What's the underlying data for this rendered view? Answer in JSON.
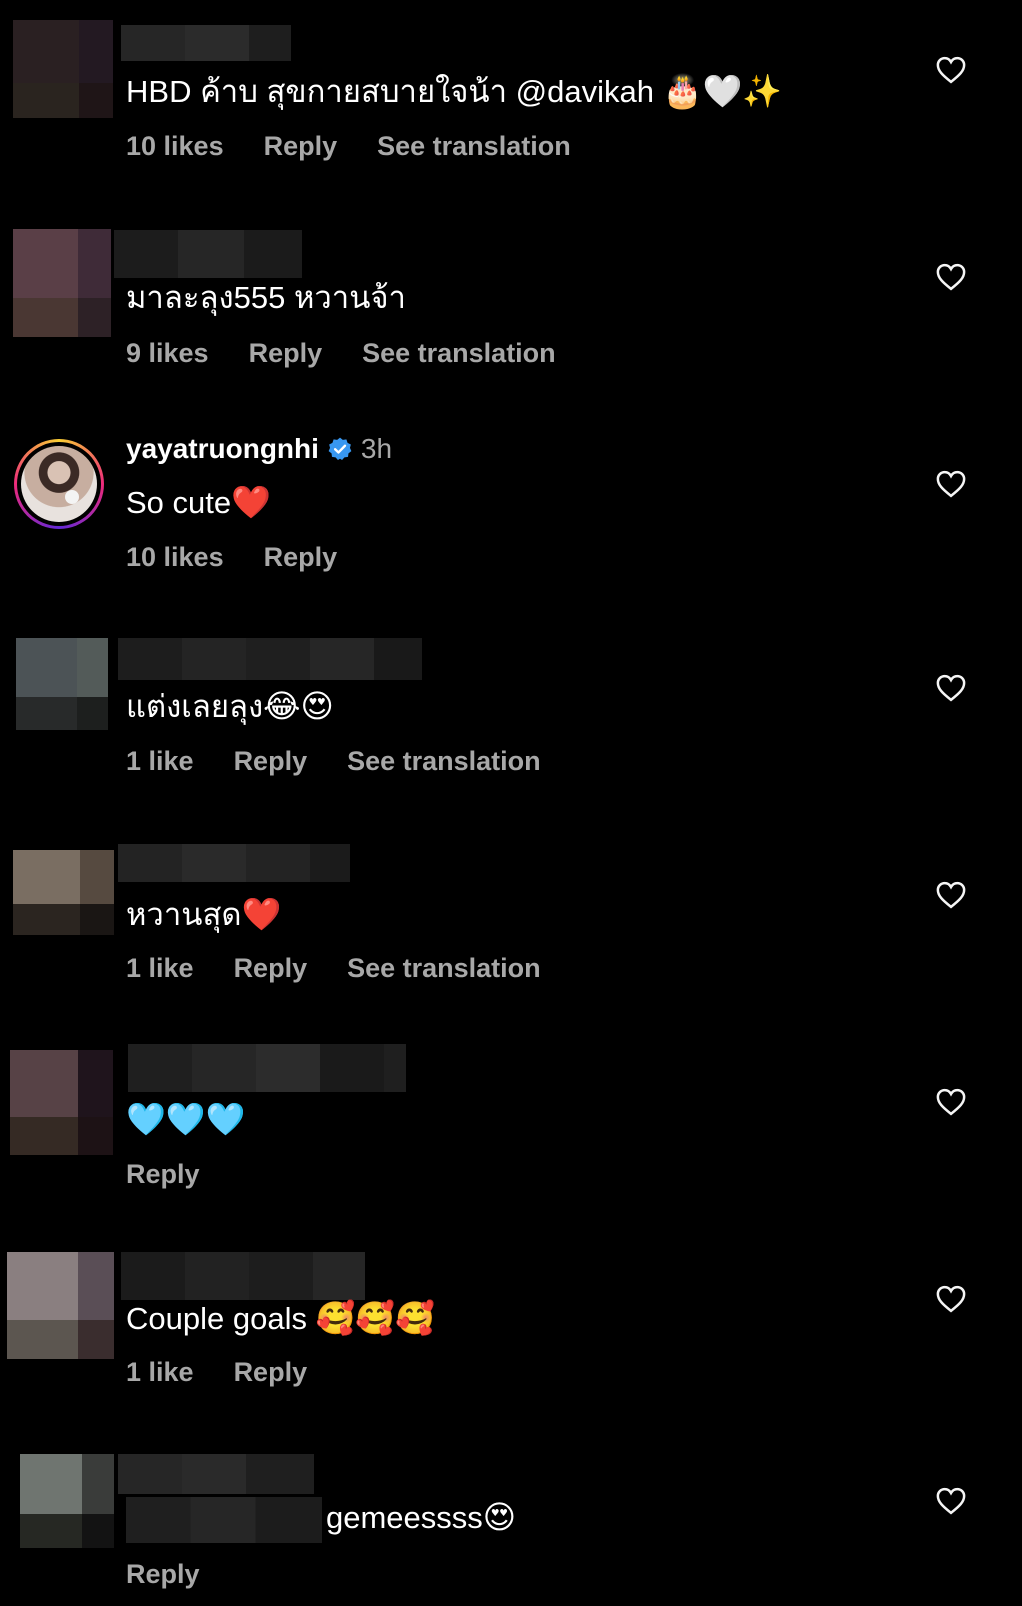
{
  "comments": [
    {
      "text": "HBD ค้าบ สุขกายสบายใจน้า @davikah",
      "emoji": "🎂🤍✨",
      "likes": "10 likes",
      "reply": "Reply",
      "translate": "See translation"
    },
    {
      "text": "มาละลุง555 หวานจ้า",
      "likes": "9 likes",
      "reply": "Reply",
      "translate": "See translation"
    },
    {
      "username": "yayatruongnhi",
      "time": "3h",
      "text": "So cute",
      "emoji": "❤️",
      "likes": "10 likes",
      "reply": "Reply"
    },
    {
      "text": "แต่งเลยลุง",
      "emoji": "😂😍",
      "likes": "1 like",
      "reply": "Reply",
      "translate": "See translation"
    },
    {
      "text": "หวานสุด",
      "emoji": "❤️",
      "likes": "1 like",
      "reply": "Reply",
      "translate": "See translation"
    },
    {
      "emoji": "🩵🩵🩵",
      "reply": "Reply"
    },
    {
      "text": "Couple goals ",
      "emoji": "🥰🥰🥰",
      "likes": "1 like",
      "reply": "Reply"
    },
    {
      "text": "gemeessss",
      "emoji": "😍",
      "reply": "Reply"
    }
  ],
  "icons": {
    "like": "heart-outline-icon",
    "verified": "verified-badge-icon"
  },
  "colors": {
    "background": "#000000",
    "primary_text": "#ffffff",
    "secondary_text": "#a8a8a8",
    "verified": "#3897f0"
  }
}
